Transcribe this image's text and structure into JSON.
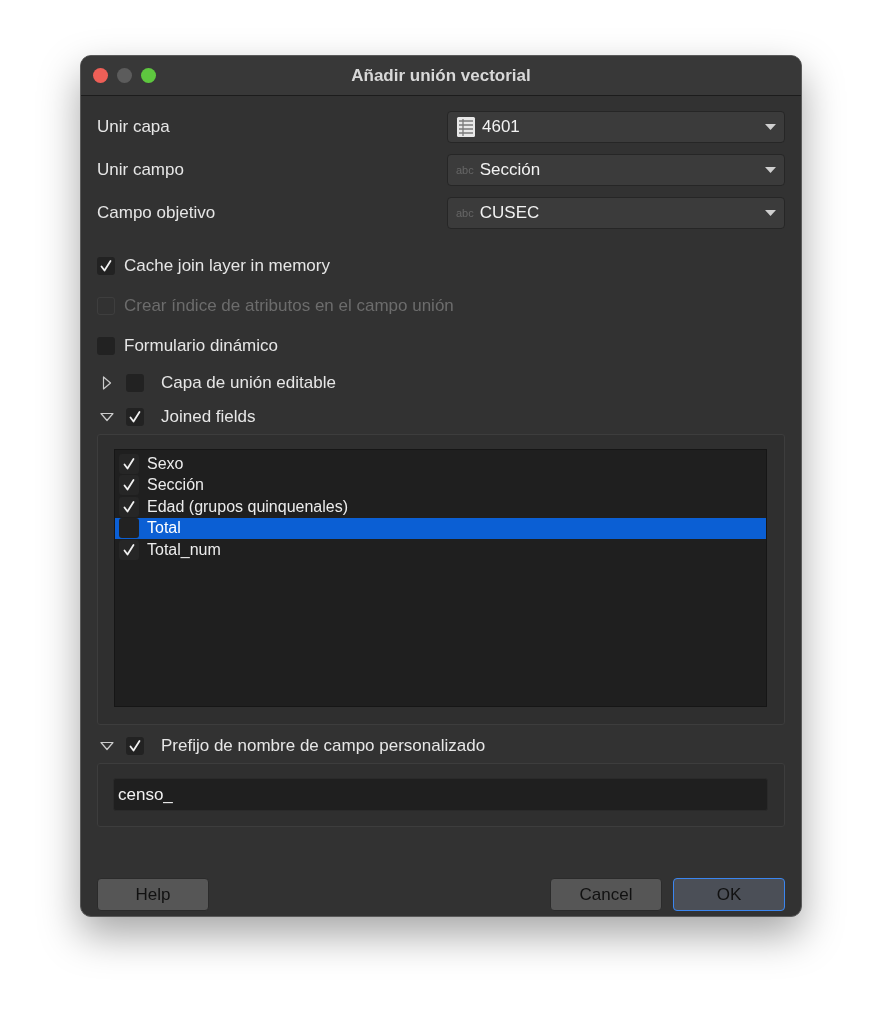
{
  "window": {
    "title": "Añadir unión vectorial"
  },
  "combos": [
    {
      "label": "Unir capa",
      "kind": "layer",
      "value": "4601"
    },
    {
      "label": "Unir campo",
      "kind": "field",
      "icon_text": "abc",
      "value": "Sección"
    },
    {
      "label": "Campo objetivo",
      "kind": "field",
      "icon_text": "abc",
      "value": "CUSEC"
    }
  ],
  "options": [
    {
      "kind": "checkbox",
      "label": "Cache join layer in memory",
      "checked": true,
      "disabled": false
    },
    {
      "kind": "checkbox",
      "label": "Crear índice de atributos en el campo unión",
      "checked": false,
      "disabled": true
    },
    {
      "kind": "checkbox",
      "label": "Formulario dinámico",
      "checked": false,
      "disabled": false
    },
    {
      "kind": "collapsible",
      "label": "Capa de unión editable",
      "checked": false,
      "expanded": false
    }
  ],
  "joined_fields": {
    "label": "Joined fields",
    "checked": true,
    "expanded": true,
    "fields": [
      {
        "name": "Sexo",
        "checked": true,
        "selected": false
      },
      {
        "name": "Sección",
        "checked": true,
        "selected": false
      },
      {
        "name": "Edad (grupos quinquenales)",
        "checked": true,
        "selected": false
      },
      {
        "name": "Total",
        "checked": false,
        "selected": true
      },
      {
        "name": "Total_num",
        "checked": true,
        "selected": false
      }
    ]
  },
  "prefix": {
    "label": "Prefijo de nombre de campo personalizado",
    "checked": true,
    "expanded": true,
    "value": "censo_"
  },
  "buttons": [
    {
      "label": "Help",
      "default": false
    },
    {
      "label": "Cancel",
      "default": false
    },
    {
      "label": "OK",
      "default": true
    }
  ]
}
